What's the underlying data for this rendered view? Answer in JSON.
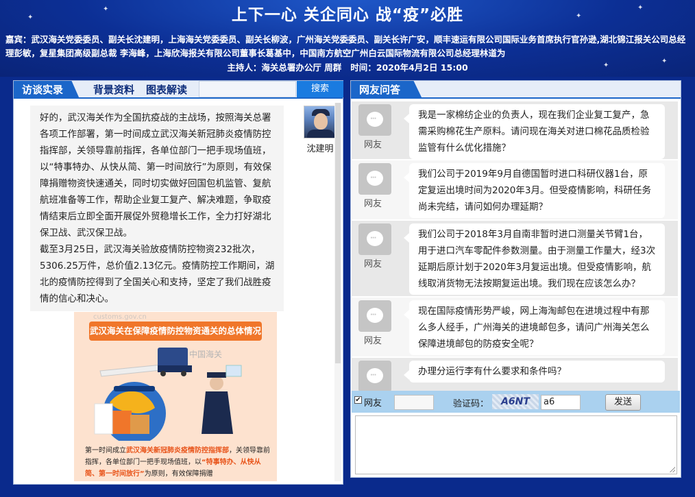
{
  "headline": "上下一心 关企同心 战“疫”必胜",
  "guests": {
    "label": "嘉宾：",
    "text": "武汉海关党委委员、副关长沈建明，上海海关党委委员、副关长柳波，广州海关党委委员、副关长许广安，顺丰速运有限公司国际业务首席执行官孙逊,湖北锦江报关公司总经理彭敏，复星集团高级副总裁 李海峰，上海欣海报关有限公司董事长葛基中，中国南方航空广州白云国际物流有限公司总经理林道为"
  },
  "host": {
    "label": "主持人：",
    "name": "海关总署办公厅 周群",
    "time_label": "时间：",
    "time": "2020年4月2日 15:00"
  },
  "left_panel": {
    "tabs": [
      "访谈实录",
      "背景资料",
      "图表解读"
    ],
    "search_button": "搜索",
    "speaker": "沈建明",
    "paragraphs": [
      "好的，武汉海关作为全国抗疫战的主战场，按照海关总署各项工作部署，第一时间成立武汉海关新冠肺炎疫情防控指挥部，关领导靠前指挥，各单位部门一把手现场值班，以“特事特办、从快从简、第一时间放行”为原则，有效保障捐赠物资快速通关，同时切实做好回国包机监管、复航航班准备等工作，帮助企业复工复产、解决难题，争取疫情结束后立即全面开展促外贸稳增长工作，全力打好湖北保卫战、武汉保卫战。",
      "截至3月25日，武汉海关验放疫情防控物资232批次，5306.25万件，总价值2.13亿元。疫情防控工作期间，湖北的疫情防控得到了全国关心和支持，坚定了我们战胜疫情的信心和决心。"
    ],
    "infographic": {
      "title": "武汉海关在保障疫情防控物资通关的总体情况",
      "text_prefix": "第一时间成立",
      "text_hl1": "武汉海关新冠肺炎疫情防控指挥部",
      "text_mid": "，关领导靠前指挥，各单位部门一把手现场值班，以",
      "text_hl2": "“特事特办、从快从简、第一时间放行”",
      "text_suffix": "为原则，有效保障捐赠",
      "watermark1": "customs.gov.cn",
      "watermark2": "中国海关"
    }
  },
  "right_panel": {
    "tab": "网友问答",
    "questions": [
      {
        "who": "网友",
        "text": "我是一家棉纺企业的负责人，现在我们企业复工复产，急需采购棉花生产原料。请问现在海关对进口棉花品质检验监管有什么优化措施？"
      },
      {
        "who": "网友",
        "text": "我们公司于2019年9月自德国暂时进口科研仪器1台，原定复运出境时间为2020年3月。但受疫情影响，科研任务尚未完结，请问如何办理延期？"
      },
      {
        "who": "网友",
        "text": "我们公司于2018年3月自南非暂时进口测量关节臂1台，用于进口汽车零配件参数测量。由于测量工作量大，经3次延期后原计划于2020年3月复运出境。但受疫情影响，航线取消货物无法按期复运出境。我们现在应该怎么办？"
      },
      {
        "who": "网友",
        "text": "现在国际疫情形势严峻，网上海淘邮包在进境过程中有那么多人经手，广州海关的进境邮包多，请问广州海关怎么保障进境邮包的防疫安全呢？"
      },
      {
        "who": "网友",
        "text": "办理分运行李有什么要求和条件吗？"
      }
    ],
    "form": {
      "checkbox_label": "网友",
      "checked": true,
      "captcha_label": "验证码：",
      "captcha_image_text": "A6NT",
      "captcha_value": "a6",
      "send_button": "发送"
    }
  },
  "colors": {
    "banner": "#0c2f95",
    "tab_active": "#1b66c9",
    "search_button": "#1a7be0",
    "form_bar": "#aad1ef",
    "highlight": "#e8541a"
  }
}
